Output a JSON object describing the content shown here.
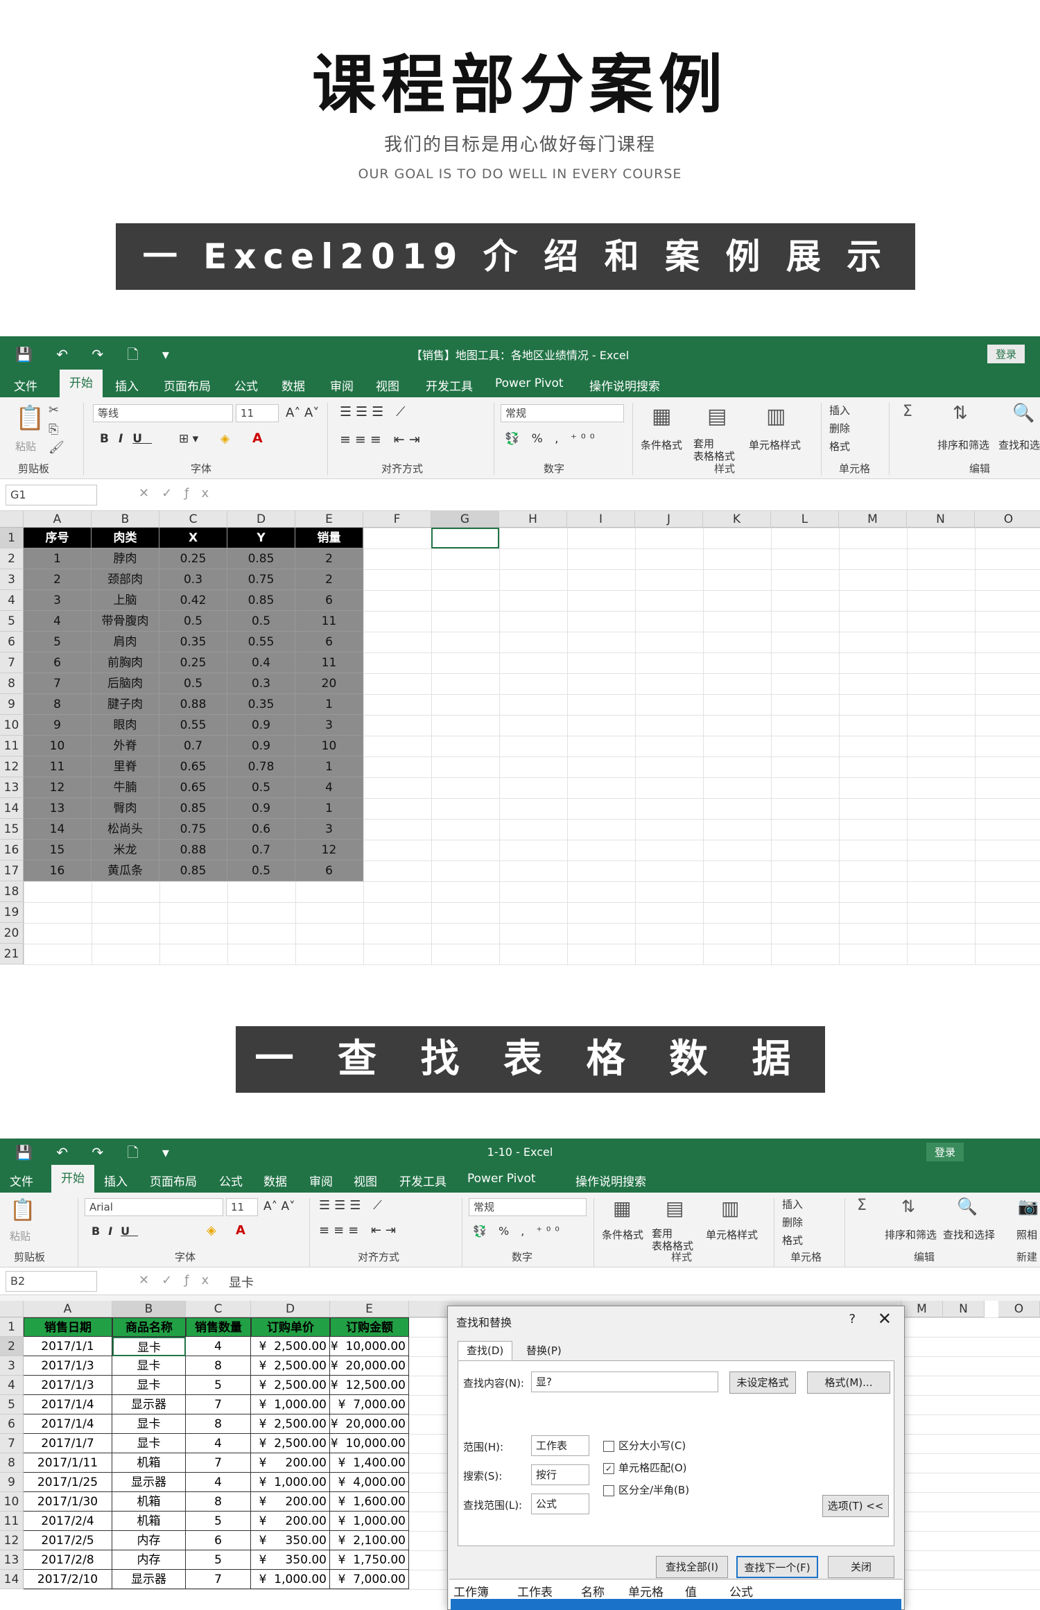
{
  "hero": {
    "title": "课程部分案例",
    "subtitle": "我们的目标是用心做好每门课程",
    "subtitle_en": "OUR GOAL IS TO DO WELL IN EVERY COURSE"
  },
  "banner1": "一 Excel2019 介 绍 和 案 例 展 示 一",
  "banner2": "一 查 找 表 格 数 据 一",
  "excel1": {
    "title": "【销售】地图工具：各地区业绩情况 - Excel",
    "login": "登录",
    "tabs": [
      "文件",
      "开始",
      "插入",
      "页面布局",
      "公式",
      "数据",
      "审阅",
      "视图",
      "开发工具",
      "Power Pivot",
      "操作说明搜索"
    ],
    "font_name": "等线",
    "font_size": "11",
    "number_format": "常规",
    "groups": [
      "剪贴板",
      "字体",
      "对齐方式",
      "数字",
      "样式",
      "单元格",
      "编辑"
    ],
    "ribbon_labels": {
      "paste": "粘贴",
      "cond": "条件格式",
      "table": "套用\n表格格式",
      "cellstyle": "单元格样式",
      "insert": "插入",
      "delete": "删除",
      "format": "格式",
      "sort": "排序和筛选",
      "find": "查找和选"
    },
    "name_box": "G1",
    "columns": [
      "A",
      "B",
      "C",
      "D",
      "E",
      "F",
      "G",
      "H",
      "I",
      "J",
      "K",
      "L",
      "M",
      "N",
      "O"
    ],
    "headers": [
      "序号",
      "肉类",
      "X",
      "Y",
      "销量"
    ],
    "rows": [
      [
        "1",
        "脖肉",
        "0.25",
        "0.85",
        "2"
      ],
      [
        "2",
        "颈部肉",
        "0.3",
        "0.75",
        "2"
      ],
      [
        "3",
        "上脑",
        "0.42",
        "0.85",
        "6"
      ],
      [
        "4",
        "带骨腹肉",
        "0.5",
        "0.5",
        "11"
      ],
      [
        "5",
        "肩肉",
        "0.35",
        "0.55",
        "6"
      ],
      [
        "6",
        "前胸肉",
        "0.25",
        "0.4",
        "11"
      ],
      [
        "7",
        "后脑肉",
        "0.5",
        "0.3",
        "20"
      ],
      [
        "8",
        "腱子肉",
        "0.88",
        "0.35",
        "1"
      ],
      [
        "9",
        "眼肉",
        "0.55",
        "0.9",
        "3"
      ],
      [
        "10",
        "外脊",
        "0.7",
        "0.9",
        "10"
      ],
      [
        "11",
        "里脊",
        "0.65",
        "0.78",
        "1"
      ],
      [
        "12",
        "牛腩",
        "0.65",
        "0.5",
        "4"
      ],
      [
        "13",
        "臀肉",
        "0.85",
        "0.9",
        "1"
      ],
      [
        "14",
        "松尚头",
        "0.75",
        "0.6",
        "3"
      ],
      [
        "15",
        "米龙",
        "0.88",
        "0.7",
        "12"
      ],
      [
        "16",
        "黄瓜条",
        "0.85",
        "0.5",
        "6"
      ]
    ],
    "row_numbers": [
      "1",
      "2",
      "3",
      "4",
      "5",
      "6",
      "7",
      "8",
      "9",
      "10",
      "11",
      "12",
      "13",
      "14",
      "15",
      "16",
      "17",
      "18",
      "19",
      "20",
      "21"
    ]
  },
  "excel2": {
    "title": "1-10 - Excel",
    "login": "登录",
    "tabs": [
      "文件",
      "开始",
      "插入",
      "页面布局",
      "公式",
      "数据",
      "审阅",
      "视图",
      "开发工具",
      "Power Pivot",
      "操作说明搜索"
    ],
    "font_name": "Arial",
    "font_size": "11",
    "number_format": "常规",
    "groups": [
      "剪贴板",
      "字体",
      "对齐方式",
      "数字",
      "样式",
      "单元格",
      "编辑",
      "新建"
    ],
    "ribbon_labels": {
      "paste": "粘贴",
      "cond": "条件格式",
      "table": "套用\n表格格式",
      "cellstyle": "单元格样式",
      "insert": "插入",
      "delete": "删除",
      "format": "格式",
      "sort": "排序和筛选",
      "find": "查找和选择",
      "photo": "照相"
    },
    "name_box": "B2",
    "formula": "显卡",
    "columns": [
      "A",
      "B",
      "C",
      "D",
      "E"
    ],
    "columns_right": [
      "M",
      "N",
      "O"
    ],
    "headers": [
      "销售日期",
      "商品名称",
      "销售数量",
      "订购单价",
      "订购金额"
    ],
    "rows": [
      [
        "2017/1/1",
        "显卡",
        "4",
        "¥  2,500.00",
        "¥  10,000.00"
      ],
      [
        "2017/1/3",
        "显卡",
        "8",
        "¥  2,500.00",
        "¥  20,000.00"
      ],
      [
        "2017/1/3",
        "显卡",
        "5",
        "¥  2,500.00",
        "¥  12,500.00"
      ],
      [
        "2017/1/4",
        "显示器",
        "7",
        "¥  1,000.00",
        "¥  7,000.00"
      ],
      [
        "2017/1/4",
        "显卡",
        "8",
        "¥  2,500.00",
        "¥  20,000.00"
      ],
      [
        "2017/1/7",
        "显卡",
        "4",
        "¥  2,500.00",
        "¥  10,000.00"
      ],
      [
        "2017/1/11",
        "机箱",
        "7",
        "¥     200.00",
        "¥  1,400.00"
      ],
      [
        "2017/1/25",
        "显示器",
        "4",
        "¥  1,000.00",
        "¥  4,000.00"
      ],
      [
        "2017/1/30",
        "机箱",
        "8",
        "¥     200.00",
        "¥  1,600.00"
      ],
      [
        "2017/2/4",
        "机箱",
        "5",
        "¥     200.00",
        "¥  1,000.00"
      ],
      [
        "2017/2/5",
        "内存",
        "6",
        "¥     350.00",
        "¥  2,100.00"
      ],
      [
        "2017/2/8",
        "内存",
        "5",
        "¥     350.00",
        "¥  1,750.00"
      ],
      [
        "2017/2/10",
        "显示器",
        "7",
        "¥  1,000.00",
        "¥  7,000.00"
      ]
    ],
    "row_numbers": [
      "1",
      "2",
      "3",
      "4",
      "5",
      "6",
      "7",
      "8",
      "9",
      "10",
      "11",
      "12",
      "13",
      "14"
    ],
    "dialog": {
      "title": "查找和替换",
      "help": "?",
      "close": "✕",
      "tab_find": "查找(D)",
      "tab_replace": "替换(P)",
      "find_label": "查找内容(N):",
      "find_value": "显?",
      "no_format": "未设定格式",
      "format_btn": "格式(M)...",
      "scope_label": "范围(H):",
      "scope_value": "工作表",
      "search_label": "搜索(S):",
      "search_value": "按行",
      "lookin_label": "查找范围(L):",
      "lookin_value": "公式",
      "match_case": "区分大小写(C)",
      "match_cell": "单元格匹配(O)",
      "match_width": "区分全/半角(B)",
      "options_btn": "选项(T) <<",
      "find_all": "查找全部(I)",
      "find_next": "查找下一个(F)",
      "close_btn": "关闭",
      "result_headers": [
        "工作簿",
        "工作表",
        "名称",
        "单元格",
        "值",
        "公式"
      ]
    }
  },
  "colors": {
    "excel_green": "#217346",
    "banner": "#3d3d3d",
    "header_fill": "#000000",
    "data_fill": "#8c8c8c",
    "header_green": "#22a045"
  }
}
